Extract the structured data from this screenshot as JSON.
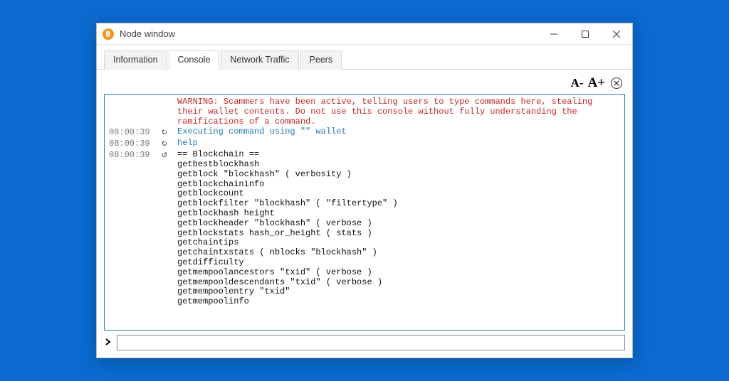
{
  "window": {
    "title": "Node window"
  },
  "tabs": {
    "information": "Information",
    "console": "Console",
    "network": "Network Traffic",
    "peers": "Peers"
  },
  "toolbar": {
    "font_decrease": "A-",
    "font_increase": "A+"
  },
  "warning": "WARNING: Scammers have been active, telling users to type commands here, stealing their wallet contents. Do not use this console without fully understanding the ramifications of a command.",
  "lines": [
    {
      "ts": "08:00:39",
      "icon": "↻",
      "cls": "info",
      "text": "Executing command using \"\" wallet"
    },
    {
      "ts": "08:00:39",
      "icon": "↻",
      "cls": "info",
      "text": "help"
    },
    {
      "ts": "08:00:39",
      "icon": "↺",
      "cls": "text",
      "text": "== Blockchain ==\ngetbestblockhash\ngetblock \"blockhash\" ( verbosity )\ngetblockchaininfo\ngetblockcount\ngetblockfilter \"blockhash\" ( \"filtertype\" )\ngetblockhash height\ngetblockheader \"blockhash\" ( verbose )\ngetblockstats hash_or_height ( stats )\ngetchaintips\ngetchaintxstats ( nblocks \"blockhash\" )\ngetdifficulty\ngetmempoolancestors \"txid\" ( verbose )\ngetmempooldescendants \"txid\" ( verbose )\ngetmempoolentry \"txid\"\ngetmempoolinfo"
    }
  ],
  "input": {
    "value": ""
  }
}
